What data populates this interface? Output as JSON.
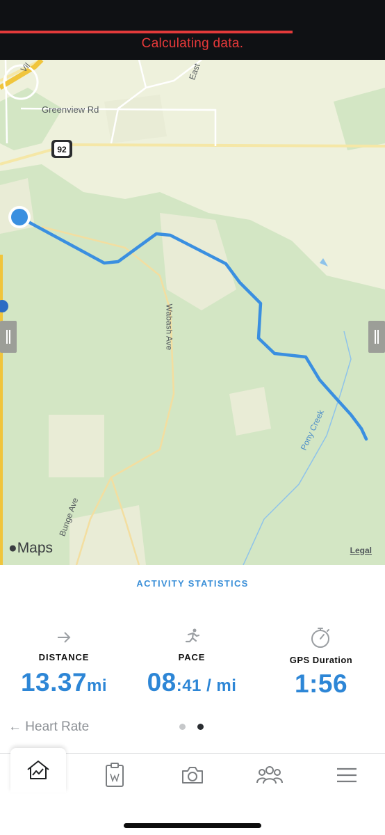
{
  "status": {
    "message": "Calculating data.",
    "progress_fraction": 0.76,
    "accent": "#e8393a"
  },
  "map": {
    "labels": {
      "greenview": "Greenview Rd",
      "route_badge": "92",
      "wabash": "Wabash Ave",
      "pony_creek": "Pony Creek",
      "bunge": "Bunge Ave",
      "easter": "East",
      "vil": "Vil"
    },
    "provider": "Maps",
    "legal": "Legal",
    "route_color": "#3a8fe0"
  },
  "stats": {
    "title": "ACTIVITY STATISTICS",
    "distance": {
      "label": "DISTANCE",
      "value": "13.37",
      "unit": "mi",
      "icon": "arrow-right-icon"
    },
    "pace": {
      "label": "PACE",
      "value_main": "08",
      "value_rest": ":41 / mi",
      "icon": "runner-icon"
    },
    "gps": {
      "label": "GPS Duration",
      "value": "1:56",
      "icon": "stopwatch-icon"
    },
    "value_color": "#2d86d6",
    "prev_link": "← Heart Rate",
    "pager": {
      "count": 2,
      "active": 1
    }
  },
  "nav": {
    "tabs": [
      {
        "name": "home",
        "icon": "home-chart-icon",
        "active": true
      },
      {
        "name": "workouts",
        "icon": "clipboard-icon",
        "active": false
      },
      {
        "name": "camera",
        "icon": "camera-icon",
        "active": false
      },
      {
        "name": "community",
        "icon": "group-icon",
        "active": false
      },
      {
        "name": "menu",
        "icon": "hamburger-icon",
        "active": false
      }
    ]
  }
}
